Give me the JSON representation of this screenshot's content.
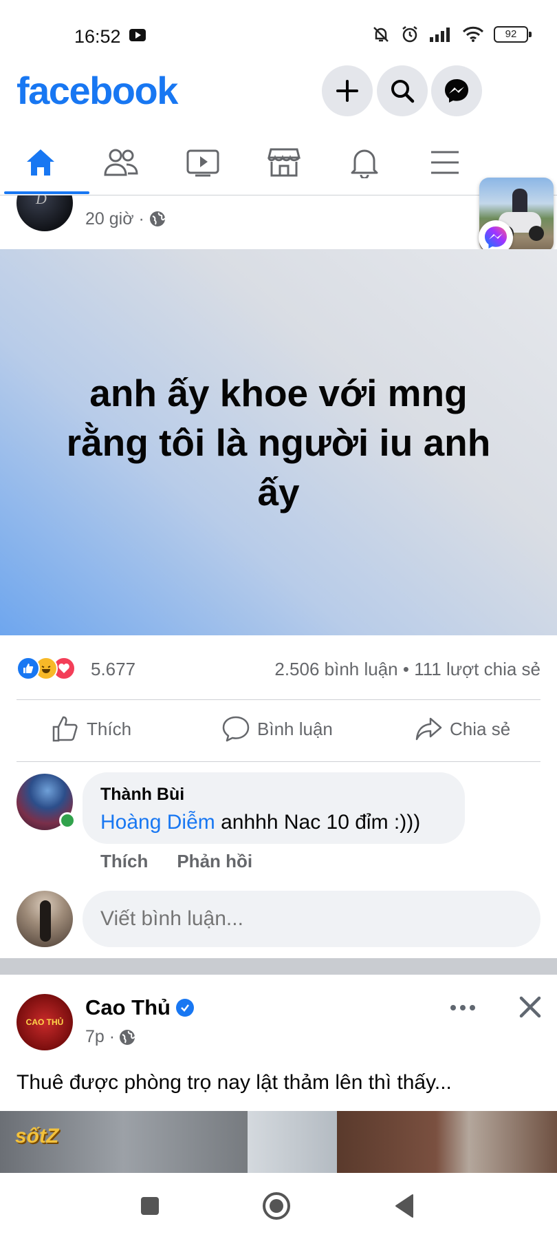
{
  "status_bar": {
    "time": "16:52",
    "battery": "92"
  },
  "header": {
    "logo": "facebook"
  },
  "post": {
    "time": "20 giờ ·",
    "text": "anh ấy khoe với mng rằng tôi là người iu anh ấy",
    "reaction_count": "5.677",
    "comments_shares": "2.506 bình luận • 111 lượt chia sẻ",
    "actions": {
      "like": "Thích",
      "comment": "Bình luận",
      "share": "Chia sẻ"
    }
  },
  "comment": {
    "author": "Thành Bùi",
    "mention": "Hoàng Diễm",
    "text": " anhhh Nac 10 đỉm :)))",
    "like": "Thích",
    "reply": "Phản hồi"
  },
  "write_comment": {
    "placeholder": "Viết bình luận..."
  },
  "post2": {
    "author": "Cao Thủ",
    "avatar_text": "CAO THỦ",
    "time": "7p ·",
    "text": "Thuê được phòng trọ nay lật thảm lên thì thấy...",
    "image_logo": "sốtZ"
  },
  "colors": {
    "brand": "#1877f2",
    "online": "#31a24c",
    "muted": "#65676b"
  },
  "icons": [
    "plus-icon",
    "search-icon",
    "messenger-icon",
    "home-icon",
    "friends-icon",
    "video-icon",
    "marketplace-icon",
    "bell-icon",
    "menu-icon",
    "globe-icon",
    "like-icon",
    "comment-icon",
    "share-icon",
    "verified-icon",
    "more-icon",
    "close-icon"
  ]
}
